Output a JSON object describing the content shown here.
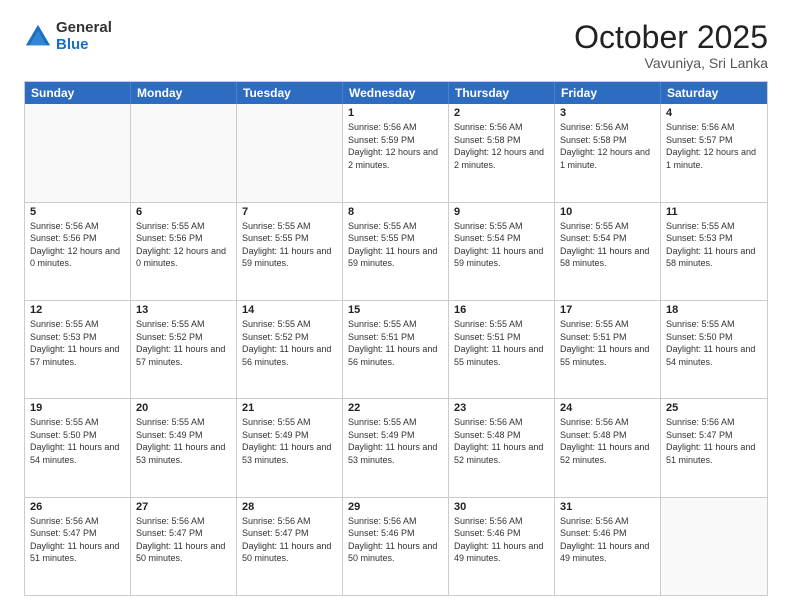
{
  "logo": {
    "general": "General",
    "blue": "Blue"
  },
  "header": {
    "month": "October 2025",
    "location": "Vavuniya, Sri Lanka"
  },
  "days": [
    "Sunday",
    "Monday",
    "Tuesday",
    "Wednesday",
    "Thursday",
    "Friday",
    "Saturday"
  ],
  "rows": [
    [
      {
        "day": "",
        "empty": true
      },
      {
        "day": "",
        "empty": true
      },
      {
        "day": "",
        "empty": true
      },
      {
        "day": "1",
        "sunrise": "5:56 AM",
        "sunset": "5:59 PM",
        "daylight": "12 hours and 2 minutes."
      },
      {
        "day": "2",
        "sunrise": "5:56 AM",
        "sunset": "5:58 PM",
        "daylight": "12 hours and 2 minutes."
      },
      {
        "day": "3",
        "sunrise": "5:56 AM",
        "sunset": "5:58 PM",
        "daylight": "12 hours and 1 minute."
      },
      {
        "day": "4",
        "sunrise": "5:56 AM",
        "sunset": "5:57 PM",
        "daylight": "12 hours and 1 minute."
      }
    ],
    [
      {
        "day": "5",
        "sunrise": "5:56 AM",
        "sunset": "5:56 PM",
        "daylight": "12 hours and 0 minutes."
      },
      {
        "day": "6",
        "sunrise": "5:55 AM",
        "sunset": "5:56 PM",
        "daylight": "12 hours and 0 minutes."
      },
      {
        "day": "7",
        "sunrise": "5:55 AM",
        "sunset": "5:55 PM",
        "daylight": "11 hours and 59 minutes."
      },
      {
        "day": "8",
        "sunrise": "5:55 AM",
        "sunset": "5:55 PM",
        "daylight": "11 hours and 59 minutes."
      },
      {
        "day": "9",
        "sunrise": "5:55 AM",
        "sunset": "5:54 PM",
        "daylight": "11 hours and 59 minutes."
      },
      {
        "day": "10",
        "sunrise": "5:55 AM",
        "sunset": "5:54 PM",
        "daylight": "11 hours and 58 minutes."
      },
      {
        "day": "11",
        "sunrise": "5:55 AM",
        "sunset": "5:53 PM",
        "daylight": "11 hours and 58 minutes."
      }
    ],
    [
      {
        "day": "12",
        "sunrise": "5:55 AM",
        "sunset": "5:53 PM",
        "daylight": "11 hours and 57 minutes."
      },
      {
        "day": "13",
        "sunrise": "5:55 AM",
        "sunset": "5:52 PM",
        "daylight": "11 hours and 57 minutes."
      },
      {
        "day": "14",
        "sunrise": "5:55 AM",
        "sunset": "5:52 PM",
        "daylight": "11 hours and 56 minutes."
      },
      {
        "day": "15",
        "sunrise": "5:55 AM",
        "sunset": "5:51 PM",
        "daylight": "11 hours and 56 minutes."
      },
      {
        "day": "16",
        "sunrise": "5:55 AM",
        "sunset": "5:51 PM",
        "daylight": "11 hours and 55 minutes."
      },
      {
        "day": "17",
        "sunrise": "5:55 AM",
        "sunset": "5:51 PM",
        "daylight": "11 hours and 55 minutes."
      },
      {
        "day": "18",
        "sunrise": "5:55 AM",
        "sunset": "5:50 PM",
        "daylight": "11 hours and 54 minutes."
      }
    ],
    [
      {
        "day": "19",
        "sunrise": "5:55 AM",
        "sunset": "5:50 PM",
        "daylight": "11 hours and 54 minutes."
      },
      {
        "day": "20",
        "sunrise": "5:55 AM",
        "sunset": "5:49 PM",
        "daylight": "11 hours and 53 minutes."
      },
      {
        "day": "21",
        "sunrise": "5:55 AM",
        "sunset": "5:49 PM",
        "daylight": "11 hours and 53 minutes."
      },
      {
        "day": "22",
        "sunrise": "5:55 AM",
        "sunset": "5:49 PM",
        "daylight": "11 hours and 53 minutes."
      },
      {
        "day": "23",
        "sunrise": "5:56 AM",
        "sunset": "5:48 PM",
        "daylight": "11 hours and 52 minutes."
      },
      {
        "day": "24",
        "sunrise": "5:56 AM",
        "sunset": "5:48 PM",
        "daylight": "11 hours and 52 minutes."
      },
      {
        "day": "25",
        "sunrise": "5:56 AM",
        "sunset": "5:47 PM",
        "daylight": "11 hours and 51 minutes."
      }
    ],
    [
      {
        "day": "26",
        "sunrise": "5:56 AM",
        "sunset": "5:47 PM",
        "daylight": "11 hours and 51 minutes."
      },
      {
        "day": "27",
        "sunrise": "5:56 AM",
        "sunset": "5:47 PM",
        "daylight": "11 hours and 50 minutes."
      },
      {
        "day": "28",
        "sunrise": "5:56 AM",
        "sunset": "5:47 PM",
        "daylight": "11 hours and 50 minutes."
      },
      {
        "day": "29",
        "sunrise": "5:56 AM",
        "sunset": "5:46 PM",
        "daylight": "11 hours and 50 minutes."
      },
      {
        "day": "30",
        "sunrise": "5:56 AM",
        "sunset": "5:46 PM",
        "daylight": "11 hours and 49 minutes."
      },
      {
        "day": "31",
        "sunrise": "5:56 AM",
        "sunset": "5:46 PM",
        "daylight": "11 hours and 49 minutes."
      },
      {
        "day": "",
        "empty": true
      }
    ]
  ]
}
